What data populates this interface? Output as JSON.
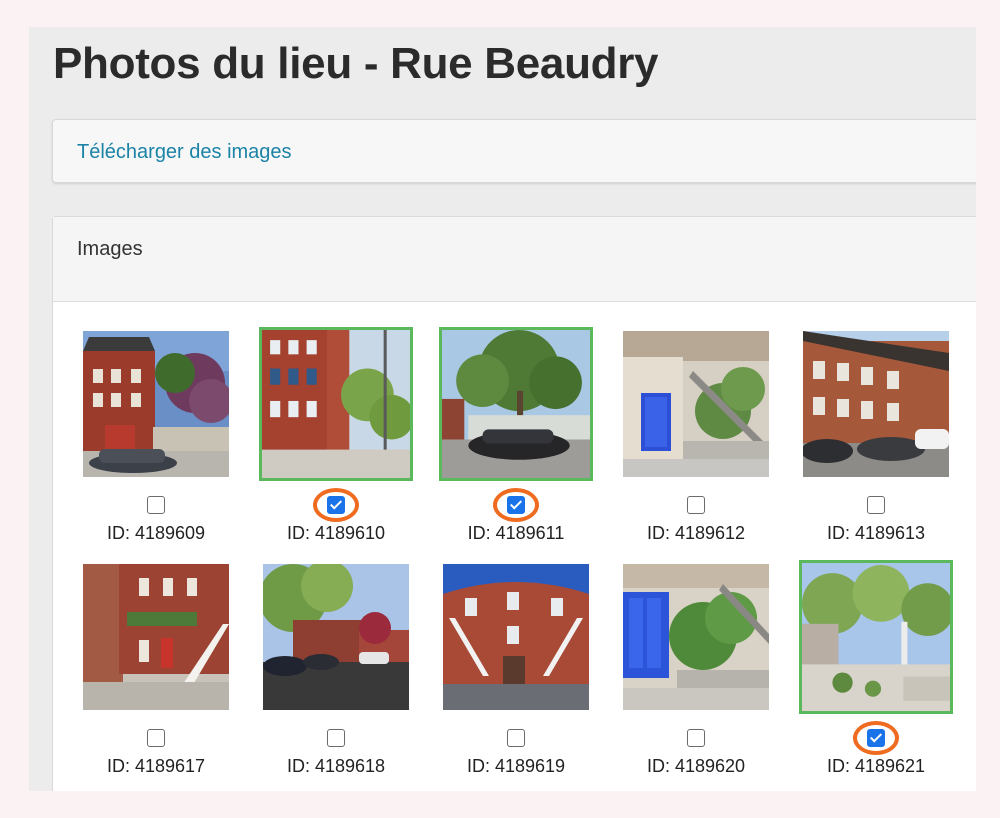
{
  "page": {
    "title": "Photos du lieu - Rue Beaudry"
  },
  "upload": {
    "label": "Télécharger des images"
  },
  "images_panel": {
    "heading": "Images"
  },
  "photos": [
    {
      "id_label": "ID: 4189609",
      "selected": false
    },
    {
      "id_label": "ID: 4189610",
      "selected": true
    },
    {
      "id_label": "ID: 4189611",
      "selected": true
    },
    {
      "id_label": "ID: 4189612",
      "selected": false
    },
    {
      "id_label": "ID: 4189613",
      "selected": false
    },
    {
      "id_label": "ID: 4189617",
      "selected": false
    },
    {
      "id_label": "ID: 4189618",
      "selected": false
    },
    {
      "id_label": "ID: 4189619",
      "selected": false
    },
    {
      "id_label": "ID: 4189620",
      "selected": false
    },
    {
      "id_label": "ID: 4189621",
      "selected": true
    }
  ],
  "colors": {
    "link": "#1b83a6",
    "selection_border": "#5cb85c",
    "highlight_ring": "#ee6b1f",
    "checkbox_checked": "#1a73e8"
  }
}
